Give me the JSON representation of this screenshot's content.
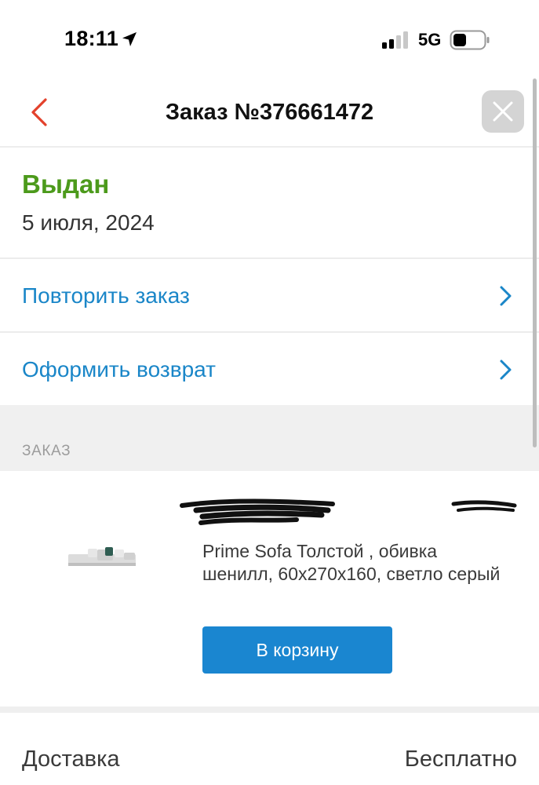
{
  "status_bar": {
    "time": "18:11",
    "network": "5G",
    "icons": [
      "location-arrow-icon",
      "cellular-signal-icon",
      "battery-icon"
    ]
  },
  "header": {
    "title": "Заказ №376661472",
    "back_icon": "chevron-left-icon",
    "close_icon": "close-icon"
  },
  "order": {
    "status": "Выдан",
    "date": "5 июля, 2024"
  },
  "actions": [
    {
      "label": "Повторить заказ",
      "icon": "chevron-right-icon"
    },
    {
      "label": "Оформить возврат",
      "icon": "chevron-right-icon"
    }
  ],
  "section": {
    "title": "ЗАКАЗ"
  },
  "product": {
    "name": "Prime Sofa Толстой , обивка шенилл, 60x270x160, светло серый",
    "cart_button": "В корзину",
    "image_icon": "sofa-thumbnail"
  },
  "delivery": {
    "label": "Доставка",
    "value": "Бесплатно"
  },
  "colors": {
    "accent": "#1a86c8",
    "button": "#1a86d0",
    "status_green": "#4c9a1b",
    "back_red": "#e3412b"
  }
}
